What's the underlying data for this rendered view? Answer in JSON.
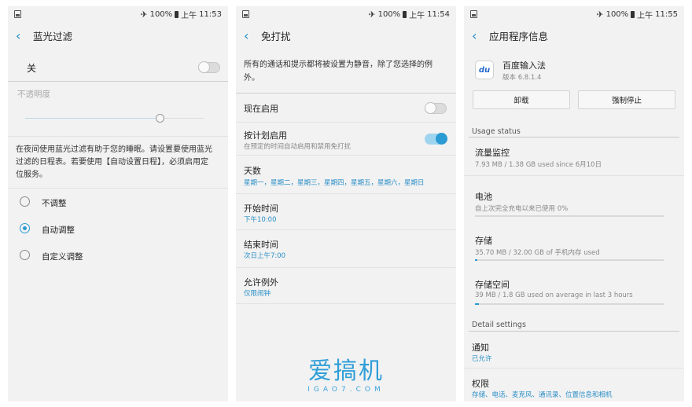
{
  "status": {
    "battery": "100%",
    "ampm": "上午"
  },
  "panel1": {
    "time": "11:53",
    "title": "蓝光过滤",
    "switch_label": "关",
    "switch_on": false,
    "opacity_label": "不透明度",
    "opacity_value": 0.75,
    "description": [
      "在夜间使用蓝光过滤有助于您的睡眠。请设置要使用蓝光",
      "过滤的日程表。若要使用【自动设置日程】，必须启用定",
      "位服务。"
    ],
    "options": [
      {
        "label": "不调整",
        "selected": false
      },
      {
        "label": "自动调整",
        "selected": true
      },
      {
        "label": "自定义调整",
        "selected": false
      }
    ]
  },
  "panel2": {
    "time": "11:54",
    "title": "免打扰",
    "description": [
      "所有的通话和提示都将被设置为静音，除了您选择的例",
      "外。"
    ],
    "now_label": "现在启用",
    "now_on": false,
    "schedule_label": "按计划启用",
    "schedule_sub": "在预定的时间自动启用和禁用免打扰",
    "schedule_on": true,
    "days_label": "天数",
    "days_value": "星期一，星期二，星期三，星期四，星期五，星期六，星期日",
    "start_label": "开始时间",
    "start_value": "下午10:00",
    "end_label": "结束时间",
    "end_value": "次日上午7:00",
    "exceptions_label": "允许例外",
    "exceptions_value": "仅限闹钟"
  },
  "panel3": {
    "time": "11:55",
    "title": "应用程序信息",
    "app_name": "百度输入法",
    "app_version": "版本 6.8.1.4",
    "app_icon_text": "du",
    "uninstall": "卸载",
    "force_stop": "强制停止",
    "usage_section": "Usage status",
    "items": [
      {
        "label": "流量监控",
        "sub": "7.93 MB / 1.38 GB used since 6月10日",
        "bar": null
      },
      {
        "label": "电池",
        "sub": "自上次完全充电以来已使用 0%",
        "bar": 0
      },
      {
        "label": "存储",
        "sub": "35.70 MB / 32.00 GB of 手机内存 used",
        "bar": 0.011
      },
      {
        "label": "存储空间",
        "sub": "39 MB / 1.8 GB used on average in last 3 hours",
        "bar": 0.021
      }
    ],
    "detail_section": "Detail settings",
    "notify_label": "通知",
    "notify_value": "已允许",
    "perm_label": "权限",
    "perm_value": "存储、电话、麦克风、通讯录、位置信息和相机"
  },
  "watermark": {
    "main": "爱搞机",
    "sub": "IGAO7.COM"
  }
}
